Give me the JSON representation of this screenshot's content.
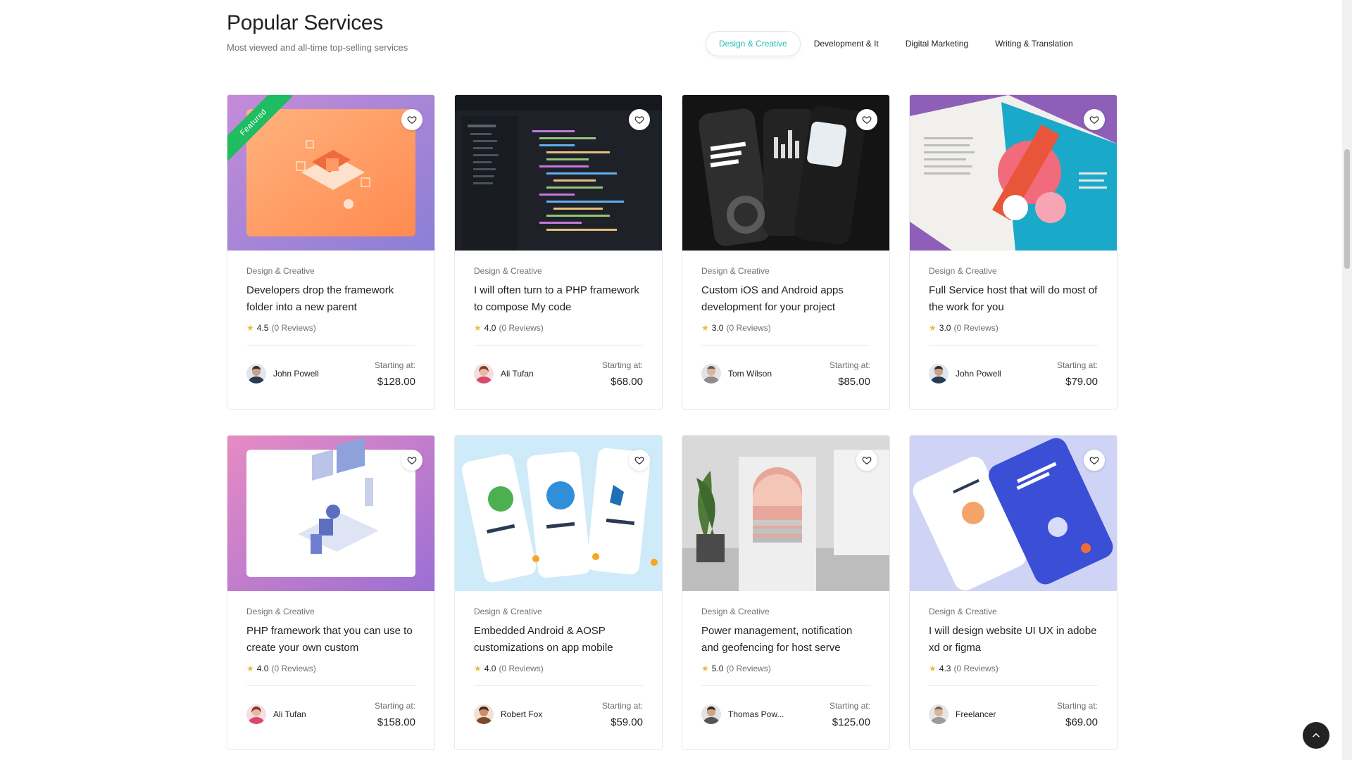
{
  "header": {
    "title": "Popular Services",
    "subtitle": "Most viewed and all-time top-selling services"
  },
  "tabs": [
    {
      "label": "Design & Creative",
      "active": true
    },
    {
      "label": "Development & It",
      "active": false
    },
    {
      "label": "Digital Marketing",
      "active": false
    },
    {
      "label": "Writing & Translation",
      "active": false
    }
  ],
  "labels": {
    "starting_at": "Starting at:",
    "featured": "Featured"
  },
  "cards": [
    {
      "category": "Design & Creative",
      "title": "Developers drop the framework folder into a new parent",
      "rating": "4.5",
      "reviews": "(0 Reviews)",
      "author": "John Powell",
      "price": "$128.00",
      "featured": true,
      "thumb": "orange-laptop"
    },
    {
      "category": "Design & Creative",
      "title": "I will often turn to a PHP framework to compose My code",
      "rating": "4.0",
      "reviews": "(0 Reviews)",
      "author": "Ali Tufan",
      "price": "$68.00",
      "featured": false,
      "thumb": "code-editor"
    },
    {
      "category": "Design & Creative",
      "title": "Custom iOS and Android apps development for your project",
      "rating": "3.0",
      "reviews": "(0 Reviews)",
      "author": "Tom Wilson",
      "price": "$85.00",
      "featured": false,
      "thumb": "finance-app"
    },
    {
      "category": "Design & Creative",
      "title": "Full Service host that will do most of the work for you",
      "rating": "3.0",
      "reviews": "(0 Reviews)",
      "author": "John Powell",
      "price": "$79.00",
      "featured": false,
      "thumb": "magazine"
    },
    {
      "category": "Design & Creative",
      "title": "PHP framework that you can use to create your own custom",
      "rating": "4.0",
      "reviews": "(0 Reviews)",
      "author": "Ali Tufan",
      "price": "$158.00",
      "featured": false,
      "thumb": "isometric-desk"
    },
    {
      "category": "Design & Creative",
      "title": "Embedded Android & AOSP customizations on app mobile",
      "rating": "4.0",
      "reviews": "(0 Reviews)",
      "author": "Robert Fox",
      "price": "$59.00",
      "featured": false,
      "thumb": "plant-app"
    },
    {
      "category": "Design & Creative",
      "title": "Power management, notification and geofencing for host serve",
      "rating": "5.0",
      "reviews": "(0 Reviews)",
      "author": "Thomas Pow...",
      "price": "$125.00",
      "featured": false,
      "thumb": "arch-room"
    },
    {
      "category": "Design & Creative",
      "title": "I will design website UI UX in adobe xd or figma",
      "rating": "4.3",
      "reviews": "(0 Reviews)",
      "author": "Freelancer",
      "price": "$69.00",
      "featured": false,
      "thumb": "food-app"
    }
  ],
  "colors": {
    "accent": "#1fbcb5",
    "featured_ribbon": "#1fbc62",
    "star": "#e1c03f"
  }
}
